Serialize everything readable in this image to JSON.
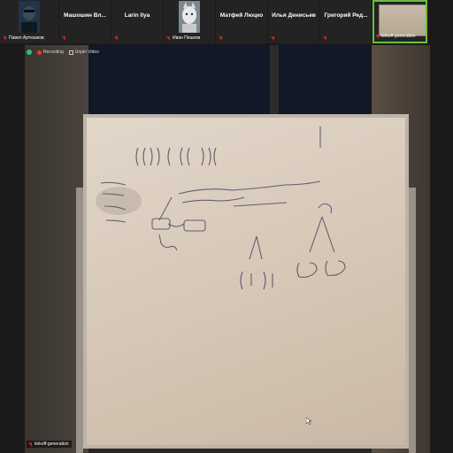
{
  "participants": [
    {
      "name": "Павел Артюшков",
      "label_style": "footer"
    },
    {
      "name": "Машошин Вл..."
    },
    {
      "name": "Larin Ilya"
    },
    {
      "name": "Иван Пешков",
      "label_style": "footer"
    },
    {
      "name": "Матфей Люцко"
    },
    {
      "name": "Илья Денисьев"
    },
    {
      "name": "Григорий Ред..."
    },
    {
      "name": "tinkoff-generation",
      "label_style": "footer",
      "active": true
    }
  ],
  "video": {
    "recording_label": "Recording",
    "unpin_label": "Unpin Video",
    "speaker_name": "tinkoff-generation"
  },
  "colors": {
    "mic_muted": "#e02020",
    "active_border": "#6cbf3b",
    "recording": "#e6392b"
  }
}
